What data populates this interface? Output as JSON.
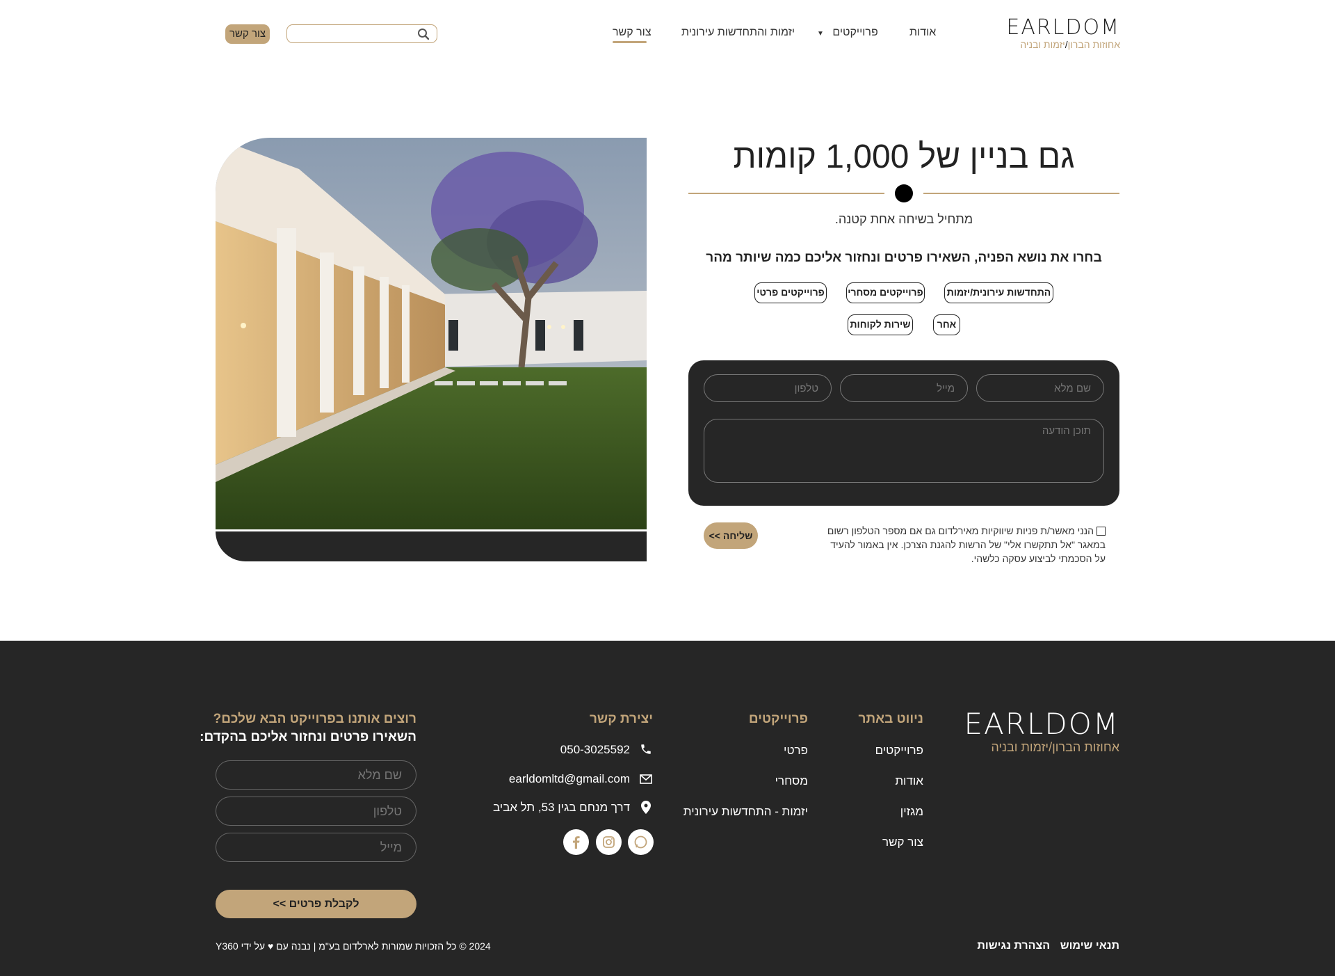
{
  "header": {
    "logo": {
      "wordmark": "EARLDOM",
      "tagline_gold": "אחוזות הברון",
      "tagline_rest": "יזמות ובניה"
    },
    "nav": [
      {
        "label": "אודות"
      },
      {
        "label": "פרוייקטים"
      },
      {
        "label": "יזמות והתחדשות עירונית"
      },
      {
        "label": "צור קשר",
        "active": true
      }
    ],
    "search": {
      "placeholder": ""
    },
    "contact_button": "צור קשר"
  },
  "hero": {
    "title": "גם בניין של 1,000 קומות",
    "subtitle": "מתחיל בשיחה אחת קטנה.",
    "instructions": "בחרו את נושא הפניה, השאירו פרטים ונחזור אליכם כמה שיותר מהר",
    "topics": [
      "התחדשות עירונית/יזמות",
      "פרוייקטים מסחרי",
      "פרוייקטים פרטי",
      "שירות לקוחות",
      "אחר"
    ],
    "form": {
      "name_placeholder": "שם מלא",
      "email_placeholder": "מייל",
      "phone_placeholder": "טלפון",
      "message_placeholder": "תוכן הודעה"
    },
    "consent": "הנני מאשר/ת פניות שיווקיות מאירלדום גם אם מספר הטלפון רשום במאגר \"אל תתקשרו אלי\" של הרשות להגנת הצרכן. אין באמור להעיד על הסכמתי לביצוע עסקה כלשהי.",
    "send_button": "שליחה >>"
  },
  "footer": {
    "logo": {
      "wordmark": "EARLDOM",
      "tagline": "אחוזות הברון/יזמות ובניה"
    },
    "site_nav": {
      "heading": "ניווט באתר",
      "links": [
        "פרוייקטים",
        "אודות",
        "מגזין",
        "צור קשר"
      ]
    },
    "projects": {
      "heading": "פרוייקטים",
      "links": [
        "פרטי",
        "מסחרי",
        "יזמות - התחדשות עירונית"
      ]
    },
    "contact": {
      "heading": "יצירת קשר",
      "phone": "050-3025592",
      "email": "earldomltd@gmail.com",
      "address": "דרך מנחם בגין 53, תל אביב",
      "socials": [
        "whatsapp-icon",
        "instagram-icon",
        "facebook-icon"
      ]
    },
    "lead": {
      "heading": "רוצים אותנו בפרוייקט הבא שלכם?",
      "subheading": "השאירו פרטים ונחזור אליכם בהקדם:",
      "name_placeholder": "שם מלא",
      "phone_placeholder": "טלפון",
      "email_placeholder": "מייל",
      "button": "לקבלת פרטים >>"
    },
    "legal": [
      "תנאי שימוש",
      "הצהרת נגישות"
    ],
    "copyright": "2024 © כל הזכויות שמורות לארלדום בע\"מ | נבנה עם ♥ על ידי Y360"
  },
  "colors": {
    "accent": "#c2a57a",
    "dark": "#262626"
  }
}
